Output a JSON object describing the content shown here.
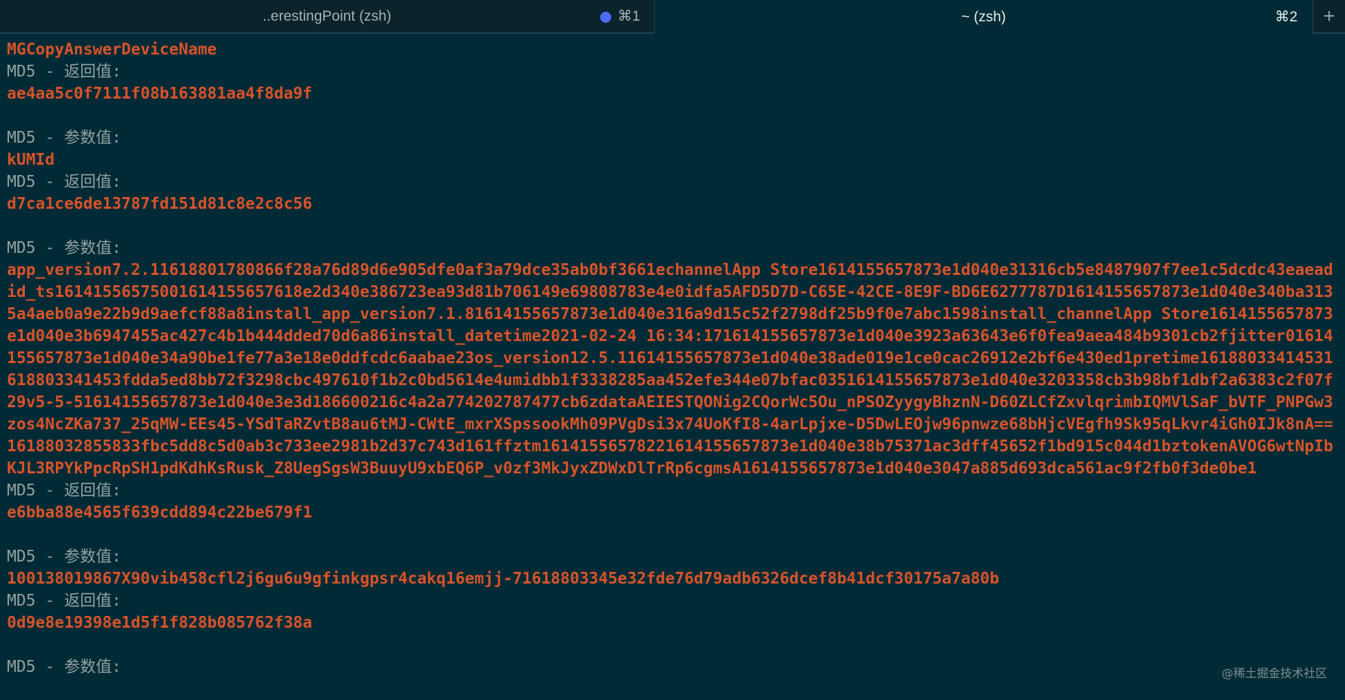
{
  "tabs": [
    {
      "title": "..erestingPoint (zsh)",
      "shortcut": "⌘1",
      "has_activity_dot": true
    },
    {
      "title": "~ (zsh)",
      "shortcut": "⌘2"
    }
  ],
  "new_tab_label": "+",
  "lines": {
    "l1": "MGCopyAnswerDeviceName",
    "l2": "MD5 - 返回值:",
    "l3": "ae4aa5c0f7111f08b163881aa4f8da9f",
    "l4": "MD5 - 参数值:",
    "l5": "kUMId",
    "l6": "MD5 - 返回值:",
    "l7": "d7ca1ce6de13787fd151d81c8e2c8c56",
    "l8": "MD5 - 参数值:",
    "l9": "app_version7.2.11618801780866f28a76d89d6e905dfe0af3a79dce35ab0bf3661echannelApp Store1614155657873e1d040e31316cb5e8487907f7ee1c5dcdc43eaeadid_ts16141556575001614155657618e2d340e386723ea93d81b706149e69808783e4e0idfa5AFD5D7D-C65E-42CE-8E9F-BD6E6277787D1614155657873e1d040e340ba3135a4aeb0a9e22b9d9aefcf88a8install_app_version7.1.81614155657873e1d040e316a9d15c52f2798df25b9f0e7abc1598install_channelApp Store1614155657873e1d040e3b6947455ac427c4b1b444dded70d6a86install_datetime2021-02-24 16:34:171614155657873e1d040e3923a63643e6f0fea9aea484b9301cb2fjitter01614155657873e1d040e34a90be1fe77a3e18e0ddfcdc6aabae23os_version12.5.11614155657873e1d040e38ade019e1ce0cac26912e2bf6e430ed1pretime16188033414531618803341453fdda5ed8bb72f3298cbc497610f1b2c0bd5614e4umidbb1f3338285aa452efe344e07bfac0351614155657873e1d040e3203358cb3b98bf1dbf2a6383c2f07f29v5-5-51614155657873e1d040e3e3d186600216c4a2a774202787477cb6zdataAEIESTQONig2CQorWc5Ou_nPSOZyygyBhznN-D60ZLCfZxvlqrimbIQMVlSaF_bVTF_PNPGw3zos4NcZKa737_25qMW-EEs45-YSdTaRZvtB8au6tMJ-CWtE_mxrXSpssookMh09PVgDsi3x74UoKfI8-4arLpjxe-D5DwLEOjw96pnwze68bHjcVEgfh9Sk95qLkvr4iGh0IJk8nA==16188032855833fbc5dd8c5d0ab3c733ee2981b2d37c743d161ffztm16141556578221614155657873e1d040e38b75371ac3dff45652f1bd915c044d1bztokenAVOG6wtNpIbKJL3RPYkPpcRpSH1pdKdhKsRusk_Z8UegSgsW3BuuyU9xbEQ6P_v0zf3MkJyxZDWxDlTrRp6cgmsA1614155657873e1d040e3047a885d693dca561ac9f2fb0f3de0be1",
    "l10": "MD5 - 返回值:",
    "l11": "e6bba88e4565f639cdd894c22be679f1",
    "l12": "MD5 - 参数值:",
    "l13": "100138019867X90vib458cfl2j6gu6u9gfinkgpsr4cakq16emjj-71618803345e32fde76d79adb6326dcef8b41dcf30175a7a80b",
    "l14": "MD5 - 返回值:",
    "l15": "0d9e8e19398e1d5f1f828b085762f38a",
    "l16": "MD5 - 参数值:"
  },
  "watermark": "@稀土掘金技术社区",
  "colors": {
    "background": "#002b36",
    "label": "#93a1a1",
    "value": "#d9532a",
    "activity_dot": "#4b6cf5"
  }
}
